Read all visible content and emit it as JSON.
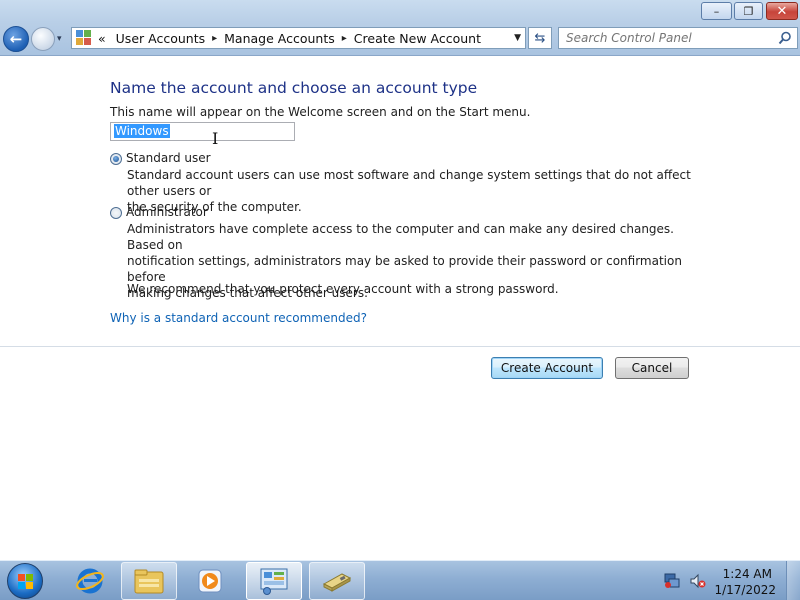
{
  "window": {
    "minimize_glyph": "–",
    "maximize_glyph": "❐",
    "close_glyph": "✕"
  },
  "nav": {
    "back_glyph": "←",
    "history_glyph": "▾",
    "refresh_glyph": "⇆"
  },
  "address": {
    "overflow_glyph": "«",
    "breadcrumbs": [
      "User Accounts",
      "Manage Accounts",
      "Create New Account"
    ],
    "separator_glyph": "▸",
    "dropdown_glyph": "▼"
  },
  "search": {
    "placeholder": "Search Control Panel"
  },
  "content": {
    "heading": "Name the account and choose an account type",
    "subtext": "This name will appear on the Welcome screen and on the Start menu.",
    "name_value": "Windows",
    "cursor_glyph": "I",
    "options": [
      {
        "label": "Standard user",
        "checked": true,
        "description": "Standard account users can use most software and change system settings that do not affect other users or\nthe security of the computer."
      },
      {
        "label": "Administrator",
        "checked": false,
        "description": "Administrators have complete access to the computer and can make any desired changes. Based on\nnotification settings, administrators may be asked to provide their password or confirmation before\nmaking changes that affect other users."
      }
    ],
    "recommendation": "We recommend that you protect every account with a strong password.",
    "help_link": "Why is a standard account recommended?",
    "create_button": "Create Account",
    "cancel_button": "Cancel"
  },
  "taskbar": {
    "items": [
      "internet-explorer",
      "windows-explorer",
      "windows-media-player",
      "control-panel",
      "removable-drive"
    ],
    "active_item": "control-panel",
    "clock_time": "1:24 AM",
    "clock_date": "1/17/2022"
  },
  "colors": {
    "heading": "#1e3287",
    "link": "#0f63b5",
    "selection": "#3399ff",
    "taskbar": "#8eaed3"
  }
}
